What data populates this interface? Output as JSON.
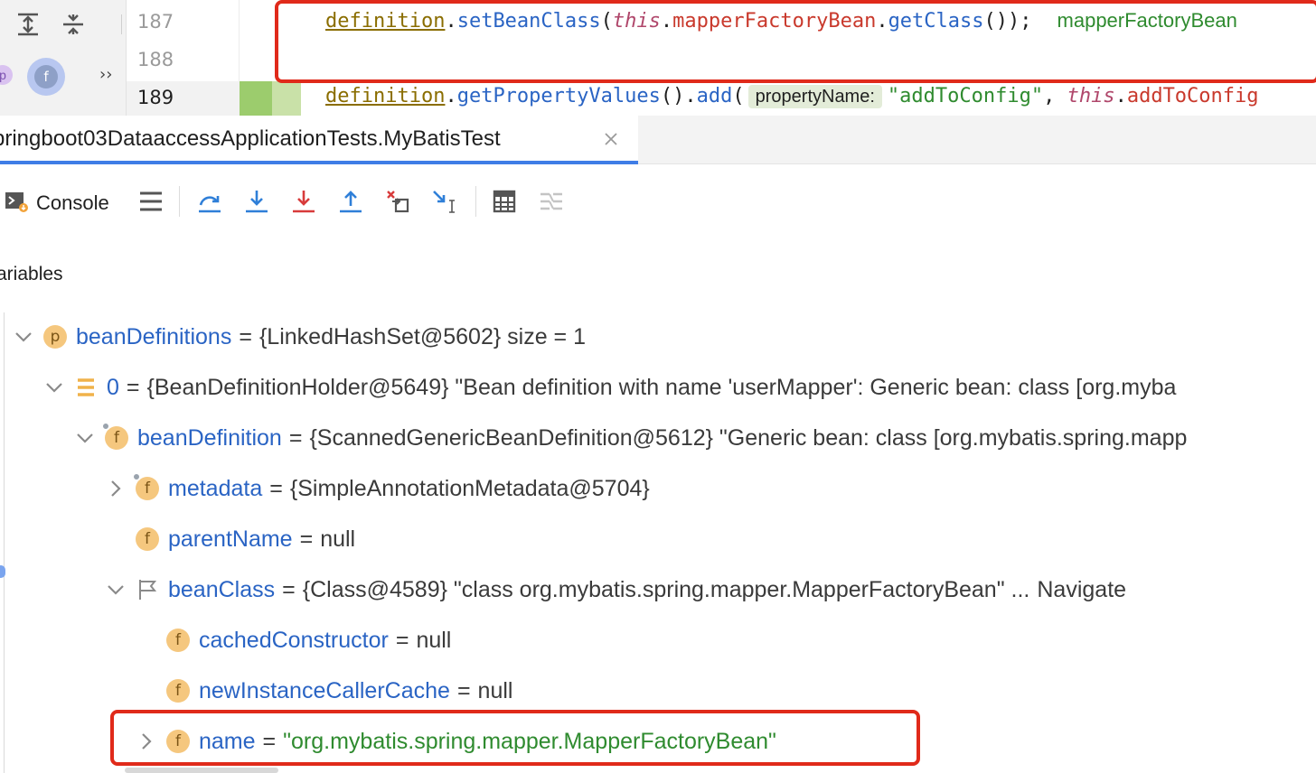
{
  "editor": {
    "line_numbers": [
      "187",
      "188",
      "189"
    ],
    "line187": {
      "def": "definition",
      "dot1": ".",
      "method1": "setBeanClass",
      "paren1": "(",
      "this": "this",
      "dot2": ".",
      "field": "mapperFactoryBean",
      "dot3": ".",
      "method2": "getClass",
      "tail": "());",
      "inline_value": "mapperFactoryBean"
    },
    "line189": {
      "def": "definition",
      "dot1": ".",
      "method1": "getPropertyValues",
      "mid": "().",
      "method2": "add",
      "paren": "(",
      "hint": "propertyName:",
      "string": "\"addToConfig\"",
      "comma": ",",
      "this": "this",
      "dot2": ".",
      "field": "addToConfig"
    }
  },
  "tab": {
    "title": "pringboot03DataaccessApplicationTests.MyBatisTest"
  },
  "toolbar": {
    "console_label": "Console"
  },
  "variables": {
    "title": "ariables",
    "rows": [
      {
        "name": "beanDefinitions",
        "eq": "=",
        "value": "{LinkedHashSet@5602}  size = 1"
      },
      {
        "name": "0",
        "eq": "=",
        "value": "{BeanDefinitionHolder@5649} \"Bean definition with name 'userMapper': Generic bean: class [org.myba"
      },
      {
        "name": "beanDefinition",
        "eq": "=",
        "value": "{ScannedGenericBeanDefinition@5612} \"Generic bean: class [org.mybatis.spring.mapp"
      },
      {
        "name": "metadata",
        "eq": "=",
        "value": "{SimpleAnnotationMetadata@5704}"
      },
      {
        "name": "parentName",
        "eq": "=",
        "value": "null"
      },
      {
        "name": "beanClass",
        "eq": "=",
        "value": "{Class@4589} \"class org.mybatis.spring.mapper.MapperFactoryBean\" ...",
        "nav": "Navigate"
      },
      {
        "name": "cachedConstructor",
        "eq": "=",
        "value": "null"
      },
      {
        "name": "newInstanceCallerCache",
        "eq": "=",
        "value": "null"
      },
      {
        "name": "name",
        "eq": "=",
        "value": "\"org.mybatis.spring.mapper.MapperFactoryBean\""
      }
    ],
    "badges": {
      "p": "p",
      "f": "f"
    }
  },
  "colors": {
    "highlight_border": "#e02a1a",
    "var_name": "#2a64c4",
    "string_value": "#2f8b2f",
    "tab_underline": "#3f7de6"
  },
  "icons": [
    "expand-all-icon",
    "collapse-all-icon",
    "console-icon",
    "menu-icon",
    "step-over-icon",
    "step-into-icon",
    "force-step-into-icon",
    "step-out-icon",
    "drop-frame-icon",
    "run-to-cursor-icon",
    "evaluate-expression-icon",
    "trace-stream-icon"
  ]
}
